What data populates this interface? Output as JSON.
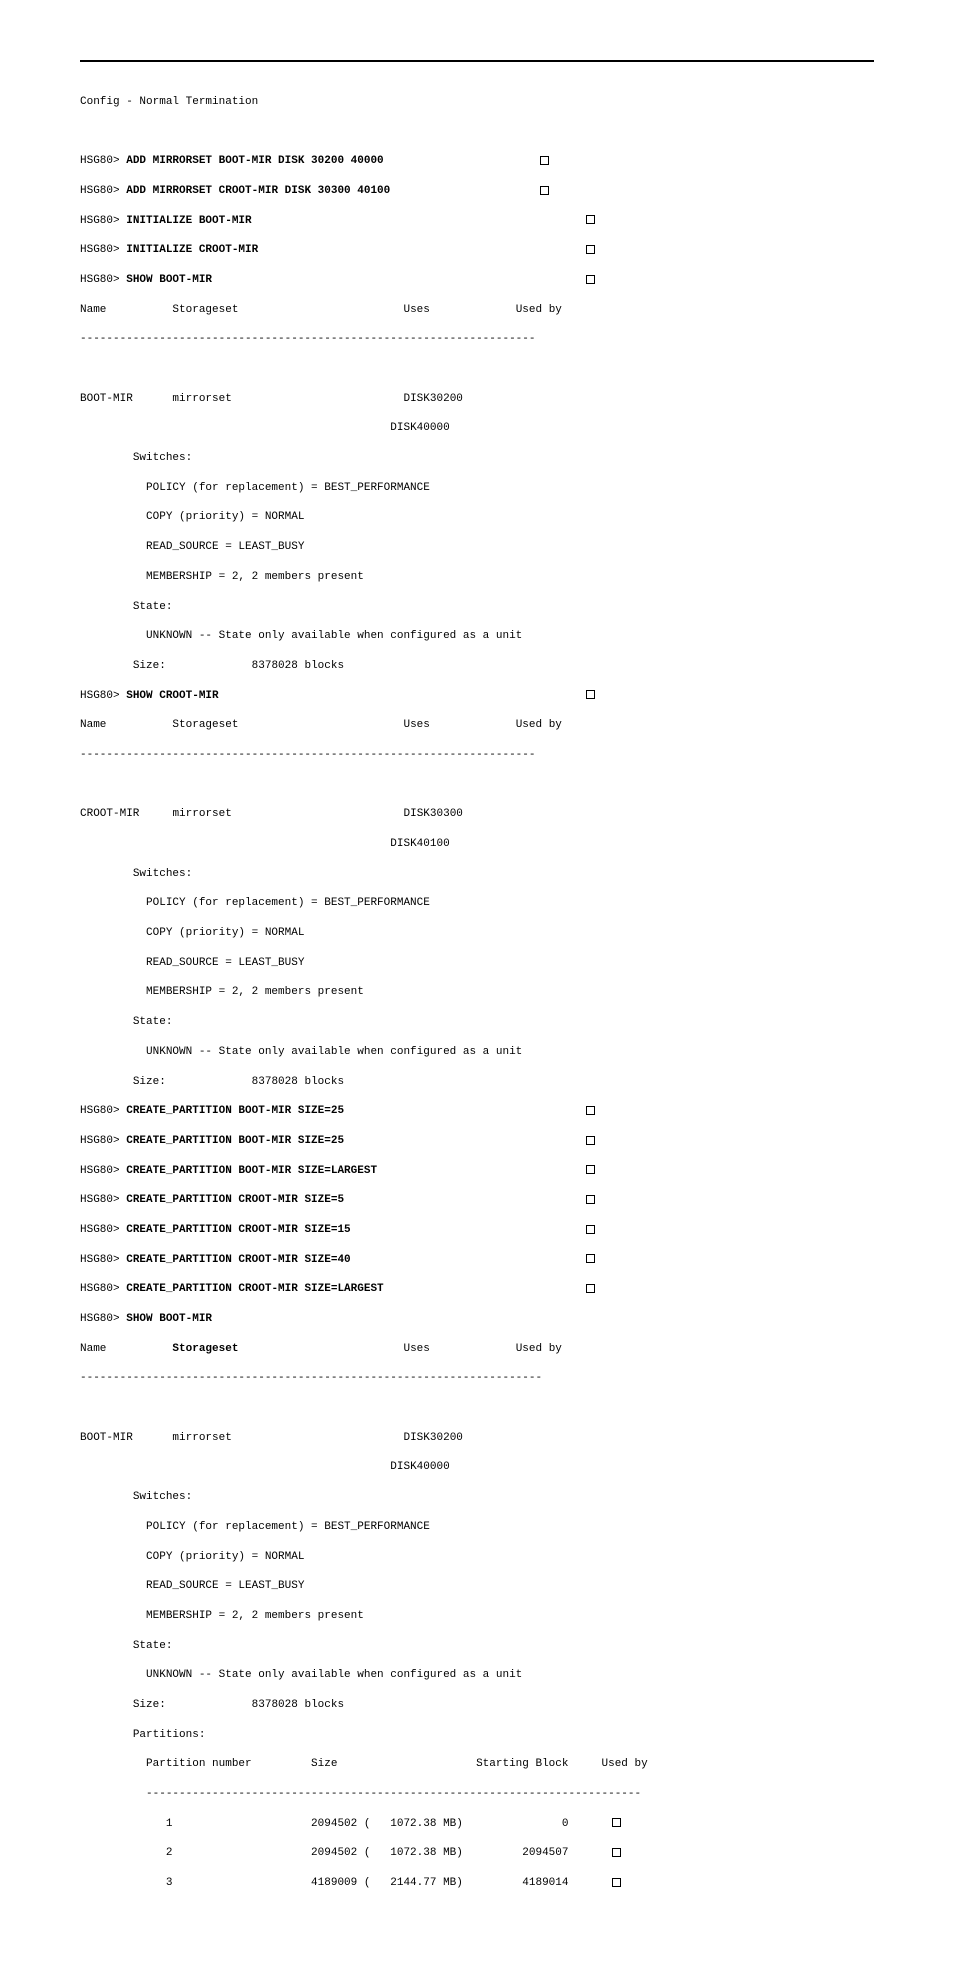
{
  "term": "Config - Normal Termination",
  "prompt": "HSG80>",
  "cmd": {
    "add_boot": "ADD MIRRORSET BOOT-MIR DISK 30200 40000",
    "add_croot": "ADD MIRRORSET CROOT-MIR DISK 30300 40100",
    "init_boot": "INITIALIZE BOOT-MIR",
    "init_croot": "INITIALIZE CROOT-MIR",
    "show_boot": "SHOW BOOT-MIR",
    "show_croot": "SHOW CROOT-MIR",
    "cp_boot25a": "CREATE_PARTITION BOOT-MIR SIZE=25",
    "cp_boot25b": "CREATE_PARTITION BOOT-MIR SIZE=25",
    "cp_boot_lg": "CREATE_PARTITION BOOT-MIR SIZE=LARGEST",
    "cp_croot5": "CREATE_PARTITION CROOT-MIR SIZE=5",
    "cp_croot15": "CREATE_PARTITION CROOT-MIR SIZE=15",
    "cp_croot40": "CREATE_PARTITION CROOT-MIR SIZE=40",
    "cp_croot_lg": "CREATE_PARTITION CROOT-MIR SIZE=LARGEST",
    "show_boot2": "SHOW BOOT-MIR"
  },
  "hdr": {
    "name": "Name",
    "storageset": "Storageset",
    "storageset_b": "Storageset",
    "uses": "Uses",
    "usedby": "Used by",
    "sep": "---------------------------------------------------------------------",
    "sep2": "----------------------------------------------------------------------"
  },
  "boot": {
    "name": "BOOT-MIR",
    "type": "mirrorset",
    "disk1": "DISK30200",
    "disk2": "DISK40000"
  },
  "croot": {
    "name": "CROOT-MIR",
    "type": "mirrorset",
    "disk1": "DISK30300",
    "disk2": "DISK40100"
  },
  "sw": {
    "hdr": "Switches:",
    "policy": "POLICY (for replacement) = BEST_PERFORMANCE",
    "copy": "COPY (priority) = NORMAL",
    "read": "READ_SOURCE = LEAST_BUSY",
    "memb": "MEMBERSHIP = 2, 2 members present"
  },
  "state": {
    "hdr": "State:",
    "unk": "UNKNOWN -- State only available when configured as a unit"
  },
  "size": {
    "hdr": "Size:",
    "val": "8378028 blocks"
  },
  "part": {
    "hdr": "Partitions:",
    "cols": "Partition number         Size                     Starting Block     Used by",
    "sep": "---------------------------------------------------------------------------",
    "r1": "   1                     2094502 (   1072.38 MB)               0",
    "r2": "   2                     2094502 (   1072.38 MB)         2094507",
    "r3": "   3                     4189009 (   2144.77 MB)         4189014"
  }
}
